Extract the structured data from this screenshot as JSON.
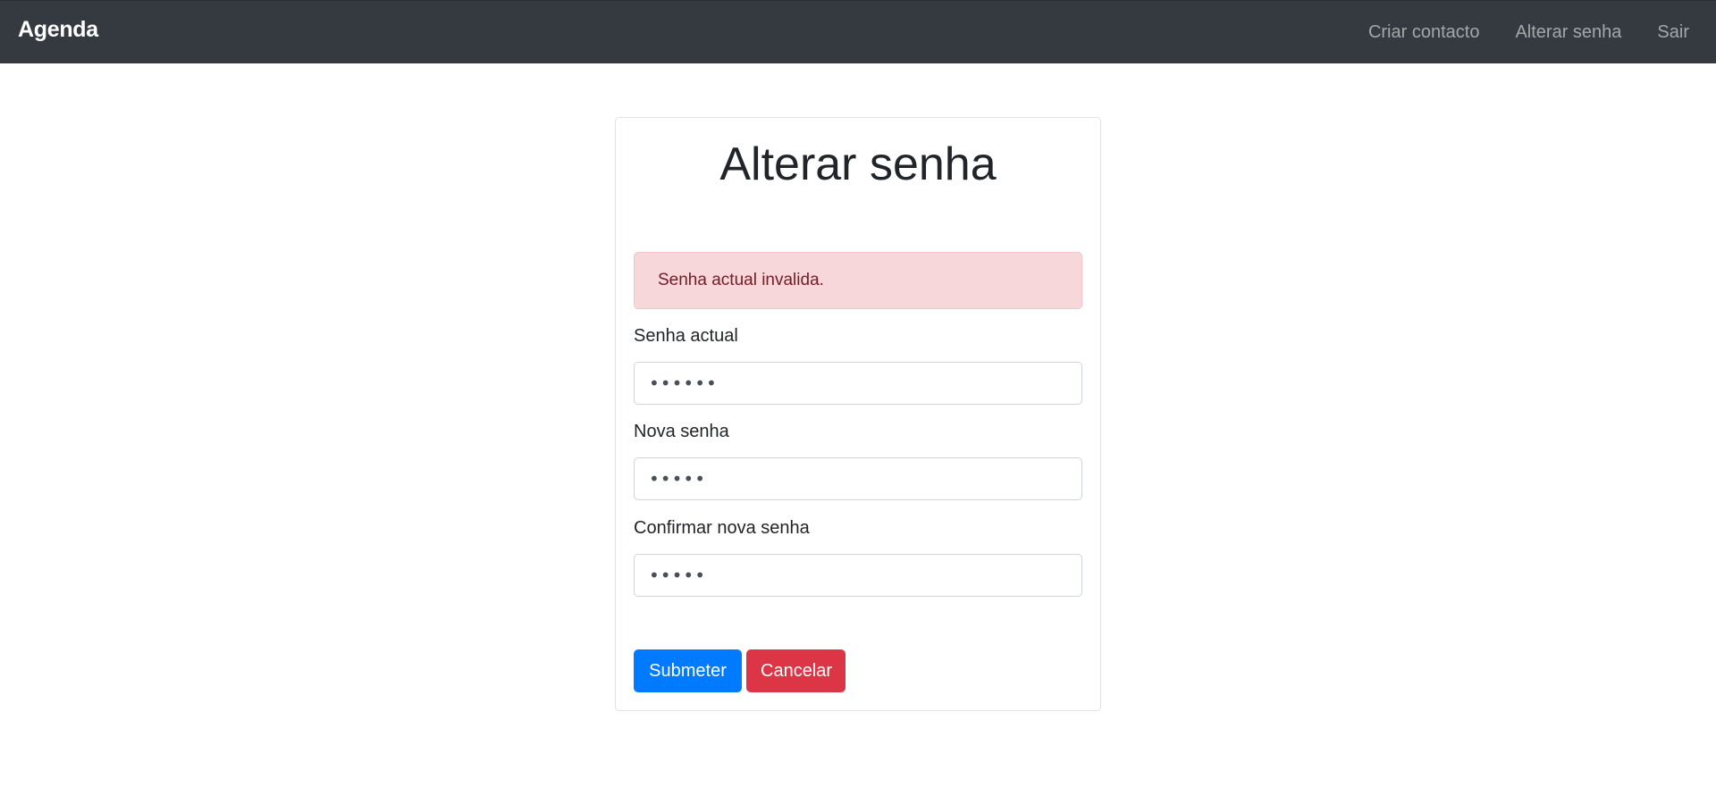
{
  "navbar": {
    "brand": "Agenda",
    "links": [
      {
        "label": "Criar contacto"
      },
      {
        "label": "Alterar senha"
      },
      {
        "label": "Sair"
      }
    ]
  },
  "form": {
    "title": "Alterar senha",
    "alert": "Senha actual invalida.",
    "fields": [
      {
        "label": "Senha actual",
        "value": "••••••"
      },
      {
        "label": "Nova senha",
        "value": "•••••"
      },
      {
        "label": "Confirmar nova senha",
        "value": "•••••"
      }
    ],
    "submit_label": "Submeter",
    "cancel_label": "Cancelar"
  },
  "colors": {
    "navbar_bg": "#343a40",
    "alert_bg": "#f8d7da",
    "primary": "#007bff",
    "danger": "#dc3545"
  }
}
